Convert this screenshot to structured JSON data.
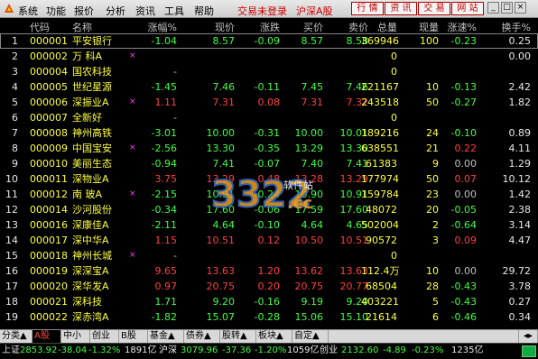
{
  "menubar": {
    "items": [
      "系统",
      "功能",
      "报价",
      "分析",
      "资讯",
      "工具",
      "帮助"
    ],
    "login_status": "交易未登录",
    "market": "沪深A股",
    "nav_buttons": [
      "行 情",
      "资 讯",
      "交 易",
      "网 站"
    ]
  },
  "header": {
    "columns": [
      "",
      "代码",
      "名称",
      "",
      "涨幅%",
      "现价",
      "涨跌",
      "买价",
      "卖价",
      "总量",
      "现量",
      "涨速%",
      "换手%"
    ]
  },
  "rows": [
    {
      "n": "1",
      "code": "000001",
      "name": "平安银行",
      "mark": "",
      "pct": "-1.04",
      "price": "8.57",
      "chg": "-0.09",
      "bid": "8.57",
      "ask": "8.58",
      "vol": "369946",
      "cur": "100",
      "spd": "-0.23",
      "turn": "0.25",
      "dir": "down"
    },
    {
      "n": "2",
      "code": "000002",
      "name": "万 科A",
      "mark": "×",
      "pct": "",
      "price": "",
      "chg": "",
      "bid": "",
      "ask": "",
      "vol": "0",
      "cur": "",
      "spd": "",
      "turn": "0.00",
      "dir": "flat"
    },
    {
      "n": "3",
      "code": "000004",
      "name": "国农科技",
      "mark": "",
      "pct": "-",
      "price": "",
      "chg": "",
      "bid": "",
      "ask": "",
      "vol": "0",
      "cur": "",
      "spd": "",
      "turn": "",
      "dir": "flat"
    },
    {
      "n": "4",
      "code": "000005",
      "name": "世纪星源",
      "mark": "",
      "pct": "-1.45",
      "price": "7.46",
      "chg": "-0.11",
      "bid": "7.45",
      "ask": "7.46",
      "vol": "221167",
      "cur": "10",
      "spd": "-0.13",
      "turn": "2.42",
      "dir": "down"
    },
    {
      "n": "5",
      "code": "000006",
      "name": "深振业A",
      "mark": "×",
      "pct": "1.11",
      "price": "7.31",
      "chg": "0.08",
      "bid": "7.31",
      "ask": "7.32",
      "vol": "243518",
      "cur": "50",
      "spd": "-0.27",
      "turn": "1.82",
      "dir": "up"
    },
    {
      "n": "6",
      "code": "000007",
      "name": "全新好",
      "mark": "",
      "pct": "-",
      "price": "",
      "chg": "",
      "bid": "",
      "ask": "",
      "vol": "0",
      "cur": "",
      "spd": "",
      "turn": "",
      "dir": "flat"
    },
    {
      "n": "7",
      "code": "000008",
      "name": "神州高铁",
      "mark": "",
      "pct": "-3.01",
      "price": "10.00",
      "chg": "-0.31",
      "bid": "10.00",
      "ask": "10.01",
      "vol": "189216",
      "cur": "24",
      "spd": "-0.10",
      "turn": "0.89",
      "dir": "down"
    },
    {
      "n": "8",
      "code": "000009",
      "name": "中国宝安",
      "mark": "×",
      "pct": "-2.56",
      "price": "13.30",
      "chg": "-0.35",
      "bid": "13.29",
      "ask": "13.30",
      "vol": "638551",
      "cur": "21",
      "spd": "0.22",
      "turn": "4.11",
      "dir": "down"
    },
    {
      "n": "9",
      "code": "000010",
      "name": "美丽生态",
      "mark": "",
      "pct": "-0.94",
      "price": "7.41",
      "chg": "-0.07",
      "bid": "7.40",
      "ask": "7.41",
      "vol": "61383",
      "cur": "9",
      "spd": "0.00",
      "turn": "1.29",
      "dir": "down"
    },
    {
      "n": "10",
      "code": "000011",
      "name": "深物业A",
      "mark": "",
      "pct": "3.75",
      "price": "13.29",
      "chg": "0.48",
      "bid": "13.28",
      "ask": "13.29",
      "vol": "177974",
      "cur": "50",
      "spd": "0.07",
      "turn": "10.12",
      "dir": "up"
    },
    {
      "n": "11",
      "code": "000012",
      "name": "南 玻A",
      "mark": "×",
      "pct": "-2.15",
      "price": "10.91",
      "chg": "-0.24",
      "bid": "10.90",
      "ask": "10.91",
      "vol": "159784",
      "cur": "23",
      "spd": "0.00",
      "turn": "1.42",
      "dir": "down"
    },
    {
      "n": "12",
      "code": "000014",
      "name": "沙河股份",
      "mark": "",
      "pct": "-0.34",
      "price": "17.60",
      "chg": "-0.06",
      "bid": "17.59",
      "ask": "17.60",
      "vol": "48072",
      "cur": "20",
      "spd": "-0.05",
      "turn": "2.38",
      "dir": "down"
    },
    {
      "n": "13",
      "code": "000016",
      "name": "深康佳A",
      "mark": "",
      "pct": "-2.11",
      "price": "4.64",
      "chg": "-0.10",
      "bid": "4.64",
      "ask": "4.65",
      "vol": "502004",
      "cur": "2",
      "spd": "-0.64",
      "turn": "3.14",
      "dir": "down"
    },
    {
      "n": "14",
      "code": "000017",
      "name": "深中华A",
      "mark": "",
      "pct": "1.15",
      "price": "10.51",
      "chg": "0.12",
      "bid": "10.50",
      "ask": "10.51",
      "vol": "90572",
      "cur": "3",
      "spd": "0.09",
      "turn": "4.47",
      "dir": "up"
    },
    {
      "n": "15",
      "code": "000018",
      "name": "神州长城",
      "mark": "×",
      "pct": "-",
      "price": "",
      "chg": "",
      "bid": "",
      "ask": "",
      "vol": "0",
      "cur": "",
      "spd": "",
      "turn": "",
      "dir": "flat"
    },
    {
      "n": "16",
      "code": "000019",
      "name": "深深宝A",
      "mark": "",
      "pct": "9.65",
      "price": "13.63",
      "chg": "1.20",
      "bid": "13.62",
      "ask": "13.63",
      "vol": "112.4万",
      "cur": "10",
      "spd": "0.00",
      "turn": "29.72",
      "dir": "up"
    },
    {
      "n": "17",
      "code": "000020",
      "name": "深华发A",
      "mark": "",
      "pct": "0.97",
      "price": "20.75",
      "chg": "0.20",
      "bid": "20.75",
      "ask": "20.77",
      "vol": "68504",
      "cur": "28",
      "spd": "-0.43",
      "turn": "3.78",
      "dir": "up"
    },
    {
      "n": "18",
      "code": "000021",
      "name": "深科技",
      "mark": "",
      "pct": "1.71",
      "price": "9.20",
      "chg": "-0.16",
      "bid": "9.19",
      "ask": "9.20",
      "vol": "403221",
      "cur": "5",
      "spd": "-0.43",
      "turn": "0.27",
      "dir": "down"
    },
    {
      "n": "19",
      "code": "000022",
      "name": "深赤湾A",
      "mark": "",
      "pct": "-1.82",
      "price": "15.07",
      "chg": "-0.28",
      "bid": "15.06",
      "ask": "15.10",
      "vol": "21614",
      "cur": "6",
      "spd": "-0.46",
      "turn": "0.34",
      "dir": "down"
    }
  ],
  "tabs": [
    "分类▲",
    "A股",
    "中小",
    "创业",
    "B股",
    "基金▲",
    "债券▲",
    "股转▲",
    "板块▲",
    "自定▲"
  ],
  "indexbar": {
    "sh_label": "上证",
    "sh_value": "2853.92",
    "sh_chg": "-38.04",
    "sh_pct": "-1.32%",
    "sh_amt": "1891亿",
    "sz_label": "沪深",
    "sz_value": "3079.96",
    "sz_chg": "-37.36",
    "sz_pct": "-1.20%",
    "sz_amt": "1059亿",
    "cy_label": "创业",
    "cy_value": "2132.60",
    "cy_chg": "-4.89",
    "cy_pct": "-0.23%",
    "cy_amt": "1235亿"
  },
  "watermark": {
    "text": "3322",
    "suffix": ".cc",
    "sub": "软件站"
  },
  "colors": {
    "up": "#ff4040",
    "down": "#40ff40",
    "code": "#ffff40",
    "accent": "#d00000"
  }
}
